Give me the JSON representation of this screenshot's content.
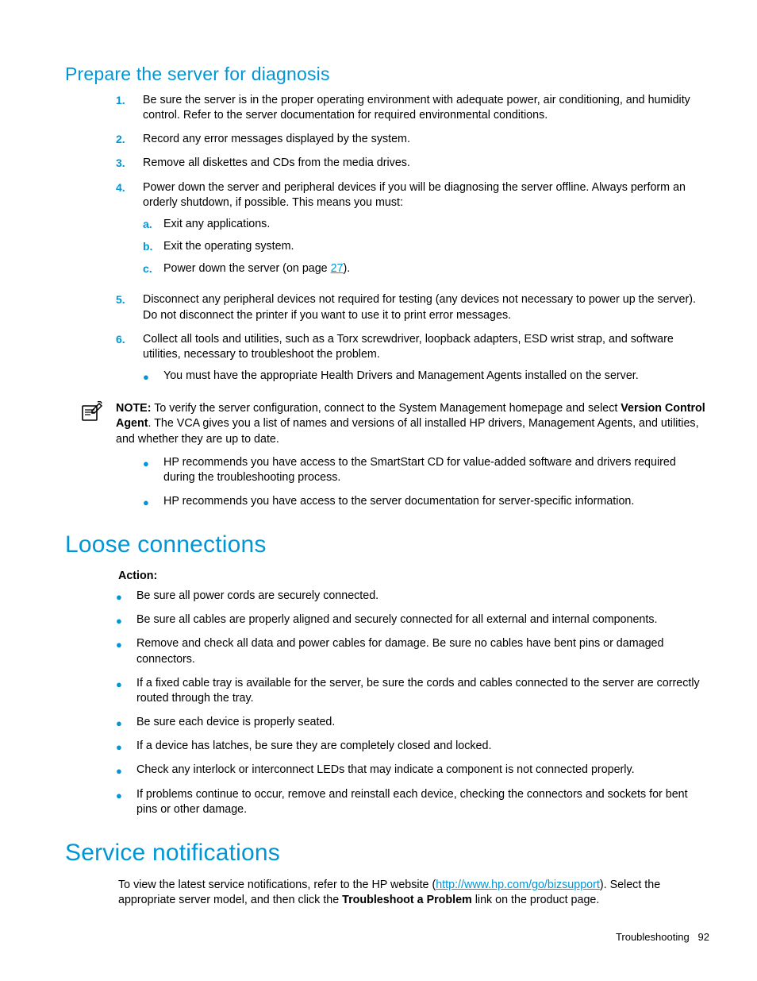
{
  "section1": {
    "title": "Prepare the server for diagnosis",
    "steps": [
      "Be sure the server is in the proper operating environment with adequate power, air conditioning, and humidity control. Refer to the server documentation for required environmental conditions.",
      "Record any error messages displayed by the system.",
      "Remove all diskettes and CDs from the media drives.",
      "Power down the server and peripheral devices if you will be diagnosing the server offline. Always perform an orderly shutdown, if possible. This means you must:",
      "Disconnect any peripheral devices not required for testing (any devices not necessary to power up the server). Do not disconnect the printer if you want to use it to print error messages.",
      "Collect all tools and utilities, such as a Torx screwdriver, loopback adapters, ESD wrist strap, and software utilities, necessary to troubleshoot the problem."
    ],
    "substeps": {
      "a": "Exit any applications.",
      "b": "Exit the operating system.",
      "c_prefix": "Power down the server (on page ",
      "c_link": "27",
      "c_suffix": ")."
    },
    "bullet6": "You must have the appropriate Health Drivers and Management Agents installed on the server.",
    "note_prefix": "NOTE:",
    "note_body1": "  To verify the server configuration, connect to the System Management homepage and select ",
    "note_bold": "Version Control Agent",
    "note_body2": ". The VCA gives you a list of names and versions of all installed HP drivers, Management Agents, and utilities, and whether they are up to date.",
    "bullets_after_note": [
      "HP recommends you have access to the SmartStart CD for value-added software and drivers required during the troubleshooting process.",
      "HP recommends you have access to the server documentation for server-specific information."
    ]
  },
  "section2": {
    "title": "Loose connections",
    "action_label": "Action",
    "bullets": [
      "Be sure all power cords are securely connected.",
      "Be sure all cables are properly aligned and securely connected for all external and internal components.",
      "Remove and check all data and power cables for damage. Be sure no cables have bent pins or damaged connectors.",
      "If a fixed cable tray is available for the server, be sure the cords and cables connected to the server are correctly routed through the tray.",
      "Be sure each device is properly seated.",
      "If a device has latches, be sure they are completely closed and locked.",
      "Check any interlock or interconnect LEDs that may indicate a component is not connected properly.",
      "If problems continue to occur, remove and reinstall each device, checking the connectors and sockets for bent pins or other damage."
    ]
  },
  "section3": {
    "title": "Service notifications",
    "para_prefix": "To view the latest service notifications, refer to the HP website (",
    "link": "http://www.hp.com/go/bizsupport",
    "para_mid": "). Select the appropriate server model, and then click the ",
    "para_bold": "Troubleshoot a Problem",
    "para_suffix": " link on the product page."
  },
  "footer": {
    "section": "Troubleshooting",
    "page": "92"
  },
  "markers": {
    "n1": "1.",
    "n2": "2.",
    "n3": "3.",
    "n4": "4.",
    "n5": "5.",
    "n6": "6.",
    "a": "a.",
    "b": "b.",
    "c": "c.",
    "bullet": "●",
    "colon": ":"
  }
}
